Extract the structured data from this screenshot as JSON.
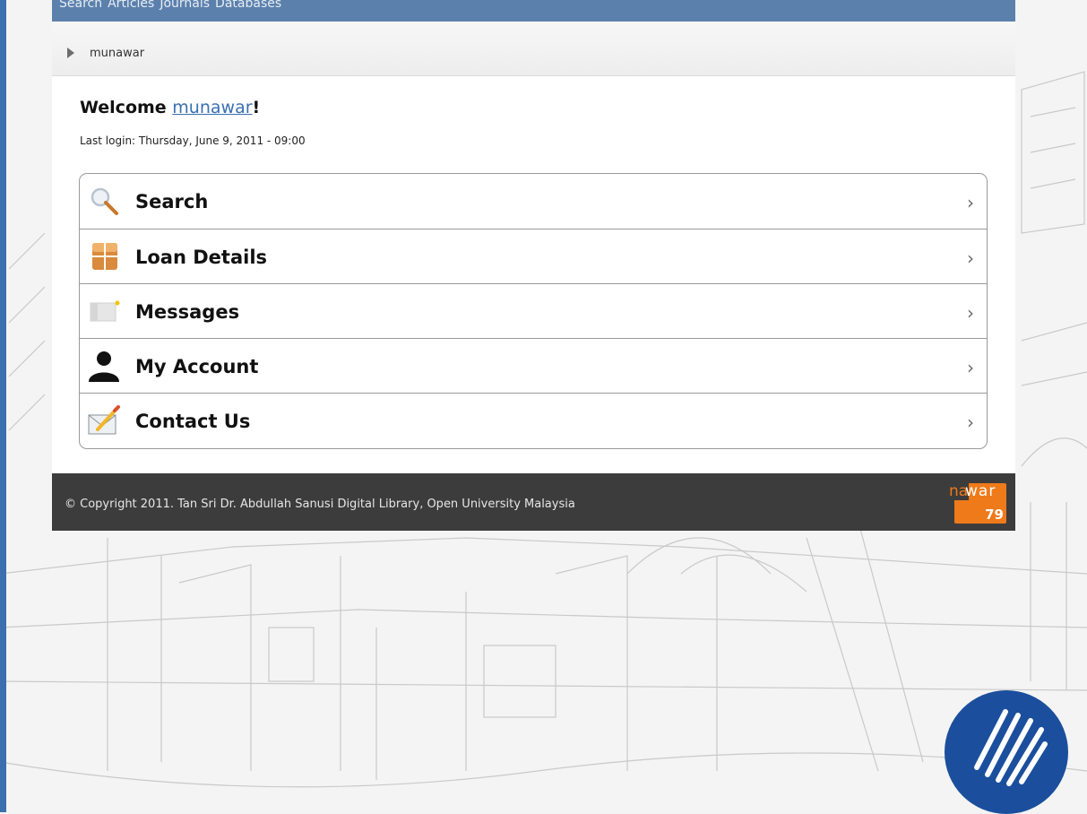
{
  "topnav": {
    "items": [
      "Search",
      "Articles",
      "Journals",
      "Databases"
    ]
  },
  "breadcrumb": {
    "label": "munawar"
  },
  "welcome": {
    "prefix": "Welcome ",
    "username": "munawar",
    "suffix": "!",
    "last_login": "Last login: Thursday, June 9, 2011 - 09:00"
  },
  "menu": {
    "items": [
      {
        "label": "Search",
        "icon": "magnifier-icon"
      },
      {
        "label": "Loan Details",
        "icon": "book-icon"
      },
      {
        "label": "Messages",
        "icon": "envelope-icon"
      },
      {
        "label": "My Account",
        "icon": "user-icon"
      },
      {
        "label": "Contact Us",
        "icon": "mail-pencil-icon"
      }
    ],
    "chevron": "›"
  },
  "footer": {
    "copyright": "© Copyright 2011. Tan Sri Dr. Abdullah Sanusi Digital Library, Open University Malaysia",
    "brand_na": "na",
    "brand_war": "war",
    "brand_num": "79"
  },
  "colors": {
    "nav_bg": "#5b80ac",
    "footer_bg": "#3c3c3c",
    "brand_orange": "#ef7a1a",
    "logo_blue": "#1b4f9d",
    "link_blue": "#3a6fb0"
  }
}
